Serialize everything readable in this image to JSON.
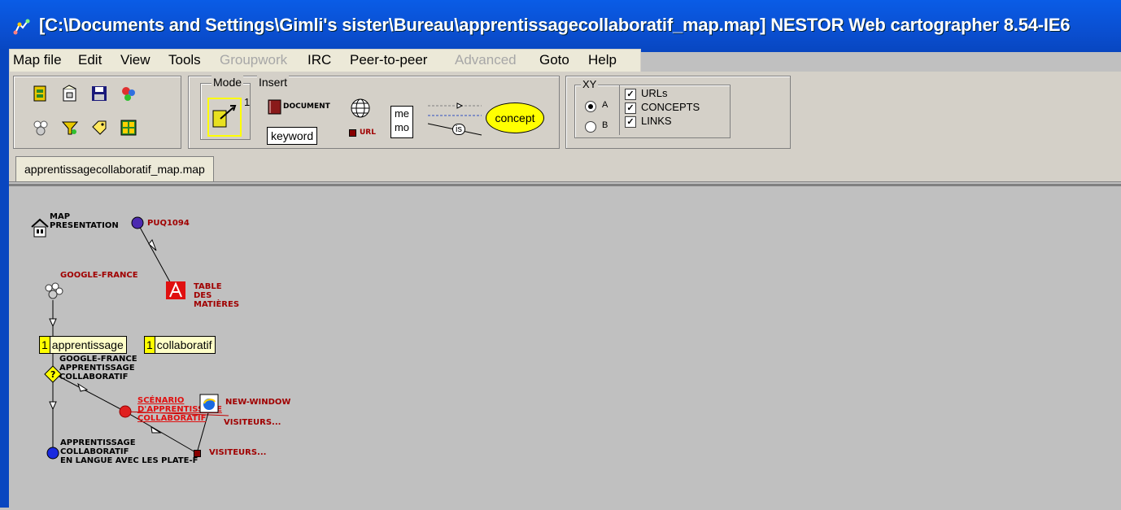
{
  "window": {
    "title": "[C:\\Documents and Settings\\Gimli's sister\\Bureau\\apprentissagecollaboratif_map.map] NESTOR Web cartographer 8.54-IE6"
  },
  "menu": [
    {
      "label": "Map file",
      "enabled": true
    },
    {
      "label": "Edit",
      "enabled": true
    },
    {
      "label": "View",
      "enabled": true
    },
    {
      "label": "Tools",
      "enabled": true
    },
    {
      "label": "Groupwork",
      "enabled": false
    },
    {
      "label": "IRC",
      "enabled": true
    },
    {
      "label": "Peer-to-peer",
      "enabled": true
    },
    {
      "label": "Advanced",
      "enabled": false
    },
    {
      "label": "Goto",
      "enabled": true
    },
    {
      "label": "Help",
      "enabled": true
    }
  ],
  "toolbar": {
    "mode_label": "Mode",
    "mode_superscript": "1",
    "insert_label": "Insert",
    "insert_document": "DOCUMENT",
    "insert_keyword": "keyword",
    "insert_url": "URL",
    "insert_memo_top": "me",
    "insert_memo_bottom": "mo",
    "insert_link_label": "is",
    "insert_concept": "concept",
    "xy_label": "XY",
    "xy_options": [
      "A",
      "B"
    ],
    "xy_selected": "A",
    "show_urls": "URLs",
    "show_concepts": "CONCEPTS",
    "show_links": "LINKS"
  },
  "tabs": [
    {
      "label": "apprentissagecollaboratif_map.map",
      "active": true
    }
  ],
  "map": {
    "map_presentation": [
      "MAP",
      "PRESENTATION"
    ],
    "puq1094": "PUQ1094",
    "google_france_top": "GOOGLE-FRANCE",
    "table_des_matieres": [
      "TABLE",
      "DES",
      "MATIÈRES"
    ],
    "keyword1": {
      "count": "1",
      "label": "apprentissage"
    },
    "keyword2": {
      "count": "1",
      "label": "collaboratif"
    },
    "google_search": [
      "GOOGLE-FRANCE",
      "APPRENTISSAGE",
      "COLLABORATIF"
    ],
    "scenario": [
      "SCÉNARIO",
      "D'APPRENTISSAGE",
      "COLLABORATIF"
    ],
    "new_window": "NEW-WINDOW",
    "visiteurs_1": "VISITEURS...",
    "visiteurs_2": "VISITEURS...",
    "apprentissage_node": [
      "APPRENTISSAGE",
      "COLLABORATIF",
      "EN LANGUE AVEC LES PLATE-F"
    ]
  },
  "colors": {
    "titlebar": "#0a5ce6",
    "node_purple": "#4b2ab0",
    "node_red": "#e02020",
    "node_blue": "#1a2ae0",
    "label_red": "#a00000",
    "concept_yellow": "#ffff00"
  }
}
